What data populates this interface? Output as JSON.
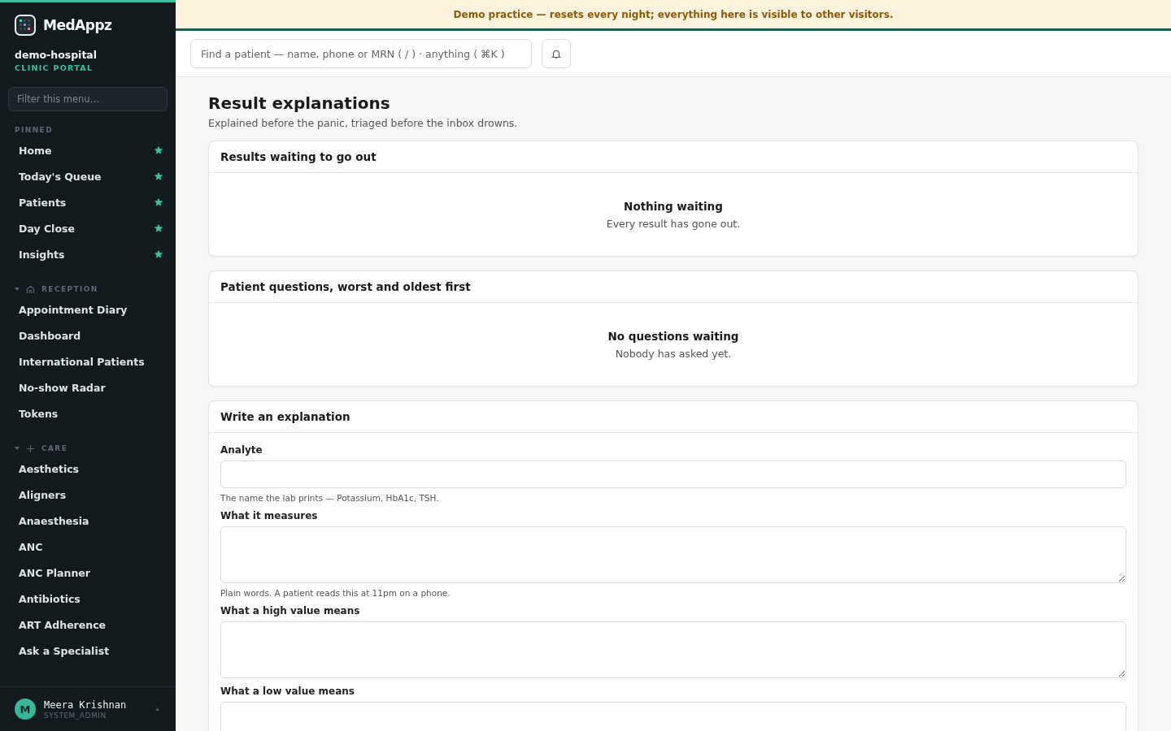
{
  "sidebar": {
    "brand": "MedAppz",
    "org": "demo-hospital",
    "portal": "CLINIC PORTAL",
    "filter_placeholder": "Filter this menu…",
    "pinned_label": "PINNED",
    "pinned": [
      {
        "label": "Home",
        "pinned": true
      },
      {
        "label": "Today's Queue",
        "pinned": true
      },
      {
        "label": "Patients",
        "pinned": true
      },
      {
        "label": "Day Close",
        "pinned": true
      },
      {
        "label": "Insights",
        "pinned": true
      }
    ],
    "groups": [
      {
        "label": "RECEPTION",
        "kind": "home",
        "expanded": true,
        "items": [
          "Appointment Diary",
          "Dashboard",
          "International Patients",
          "No-show Radar",
          "Tokens"
        ]
      },
      {
        "label": "CARE",
        "kind": "plus",
        "expanded": true,
        "items": [
          "Aesthetics",
          "Aligners",
          "Anaesthesia",
          "ANC",
          "ANC Planner",
          "Antibiotics",
          "ART Adherence",
          "Ask a Specialist"
        ]
      }
    ],
    "user": {
      "initial": "M",
      "name": "Meera Krishnan",
      "role": "SYSTEM_ADMIN"
    }
  },
  "banner": "Demo practice — resets every night; everything here is visible to other visitors.",
  "search": {
    "placeholder": "Find a patient — name, phone or MRN ( / ) · anything ( ⌘K )"
  },
  "page": {
    "title": "Result explanations",
    "subtitle": "Explained before the panic, triaged before the inbox drowns."
  },
  "cards": [
    {
      "title": "Results waiting to go out",
      "kind": "empty",
      "empty_title": "Nothing waiting",
      "empty_text": "Every result has gone out."
    },
    {
      "title": "Patient questions, worst and oldest first",
      "kind": "empty",
      "empty_title": "No questions waiting",
      "empty_text": "Nobody has asked yet."
    },
    {
      "title": "Write an explanation",
      "kind": "form",
      "fields": [
        {
          "label": "Analyte",
          "kind": "input",
          "hint": "The name the lab prints — Potassium, HbA1c, TSH."
        },
        {
          "label": "What it measures",
          "kind": "textarea",
          "hint": "Plain words. A patient reads this at 11pm on a phone."
        },
        {
          "label": "What a high value means",
          "kind": "textarea"
        },
        {
          "label": "What a low value means",
          "kind": "textarea"
        }
      ]
    }
  ]
}
